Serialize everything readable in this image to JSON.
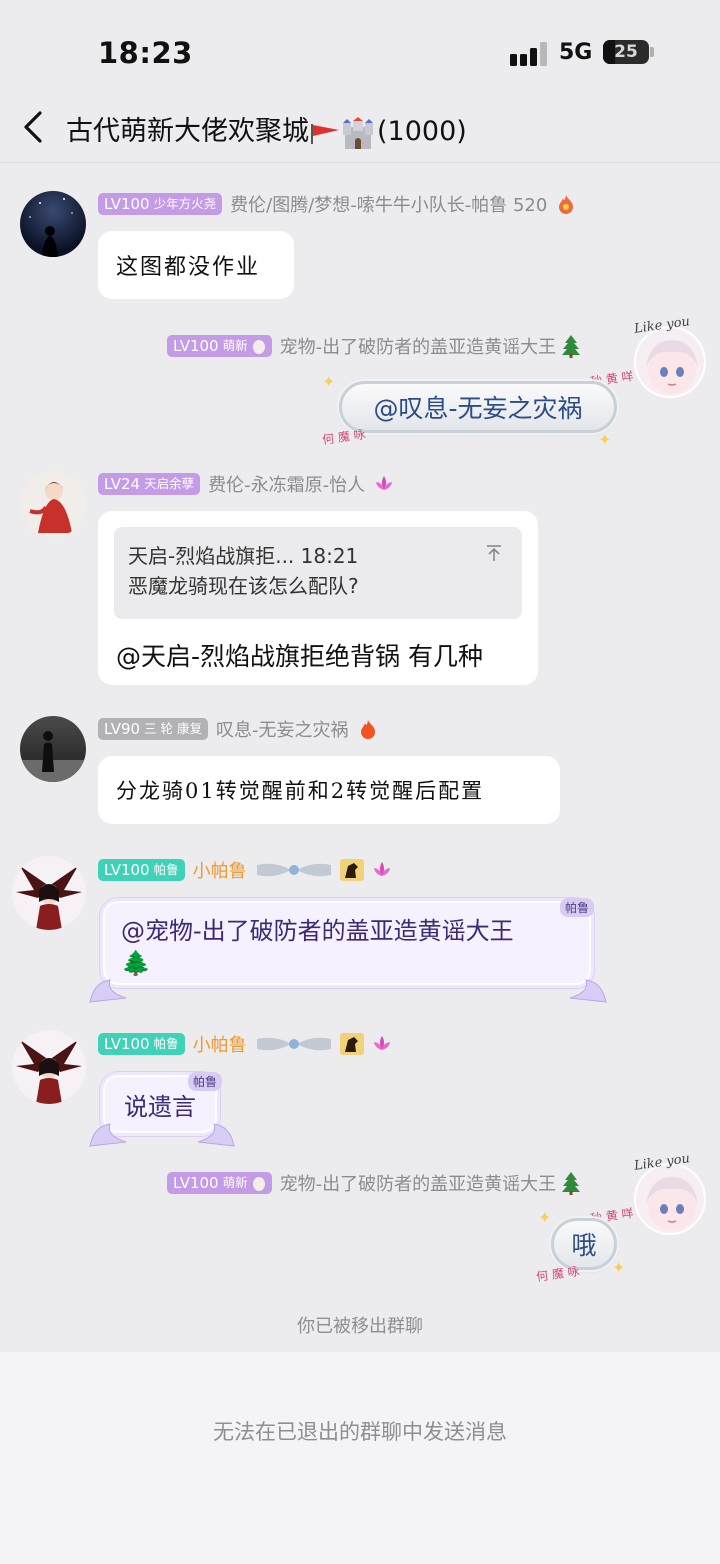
{
  "status_bar": {
    "time": "18:23",
    "network": "5G",
    "battery": "25",
    "battery_level": 0.25
  },
  "header": {
    "title": "古代萌新大佬欢聚城",
    "member_count": "(1000)"
  },
  "messages": [
    {
      "level": "LV100",
      "level_title": "少年方火尧",
      "nickname": "费伦/图腾/梦想-嗦牛牛小队长-帕鲁 520",
      "text": "这图都没作业"
    },
    {
      "level": "LV100",
      "level_title": "萌新",
      "nickname": "宠物-出了破防者的盖亚造黄谣大王",
      "text": "@叹息-无妄之灾祸",
      "deco_top": "Like you",
      "deco_name": "秒 黄 咩",
      "deco_bottom": "何 魔 咏"
    },
    {
      "level": "LV24",
      "level_title": "天启余孽",
      "nickname": "费伦-永冻霜原-怡人",
      "quote_author": "天启-烈焰战旗拒... 18:21",
      "quote_text": "恶魔龙骑现在该怎么配队?",
      "text": "@天启-烈焰战旗拒绝背锅 有几种"
    },
    {
      "level": "LV90",
      "level_title": "三 轮 康复",
      "nickname": "叹息-无妄之灾祸",
      "text": "分龙骑01转觉醒前和2转觉醒后配置"
    },
    {
      "level": "LV100",
      "level_title": "帕鲁",
      "nickname": "小帕鲁",
      "text_line1": "@宠物-出了破防者的盖亚造黄谣大王",
      "emoji": "🌲",
      "tag": "帕鲁"
    },
    {
      "level": "LV100",
      "level_title": "帕鲁",
      "nickname": "小帕鲁",
      "text": "说遗言",
      "tag": "帕鲁"
    },
    {
      "level": "LV100",
      "level_title": "萌新",
      "nickname": "宠物-出了破防者的盖亚造黄谣大王",
      "text": "哦",
      "deco_top": "Like you",
      "deco_name": "秒 黄 咩",
      "deco_bottom": "何 魔 咏"
    }
  ],
  "system_notice": "你已被移出群聊",
  "footer_notice": "无法在已退出的群聊中发送消息"
}
